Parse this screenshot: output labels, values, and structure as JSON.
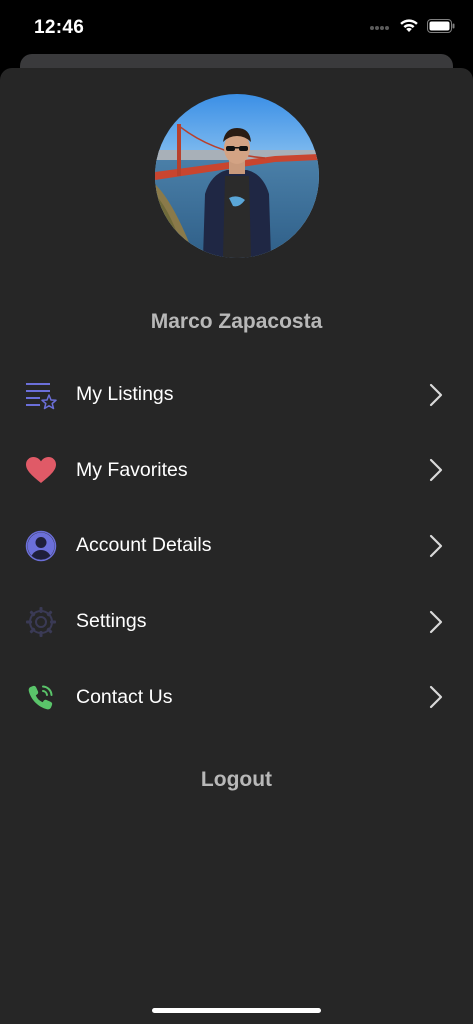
{
  "status_bar": {
    "time": "12:46"
  },
  "profile": {
    "name": "Marco Zapacosta"
  },
  "menu": {
    "items": [
      {
        "label": "My Listings",
        "icon": "listings-star-icon",
        "icon_color": "#6b6fd9"
      },
      {
        "label": "My Favorites",
        "icon": "heart-icon",
        "icon_color": "#e05a67"
      },
      {
        "label": "Account Details",
        "icon": "user-circle-icon",
        "icon_color": "#6b6fd9"
      },
      {
        "label": "Settings",
        "icon": "gear-icon",
        "icon_color": "#3a3a55"
      },
      {
        "label": "Contact Us",
        "icon": "phone-icon",
        "icon_color": "#5ac46a"
      }
    ]
  },
  "logout_label": "Logout",
  "colors": {
    "background": "#262626",
    "accent": "#6b6fd9",
    "muted_text": "#b8b8b8"
  }
}
